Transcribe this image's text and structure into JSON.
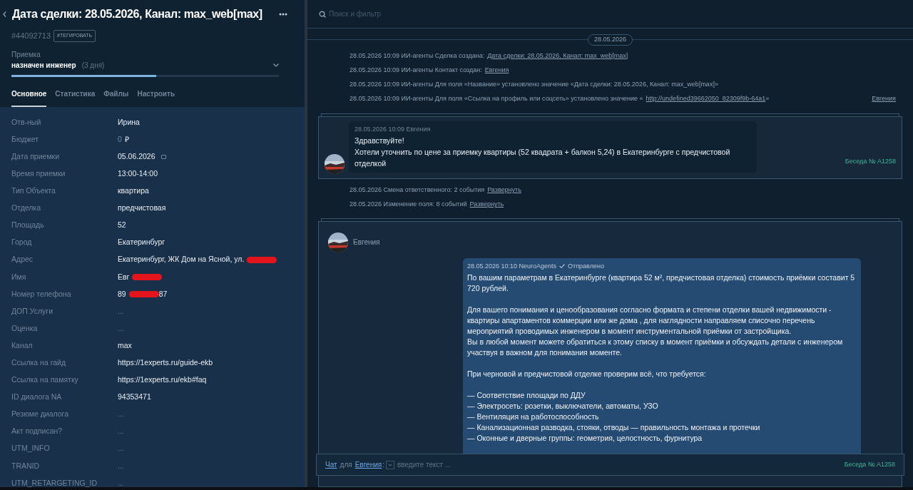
{
  "lead": {
    "title": "Дата сделки: 28.05.2026, Канал: max_web[max]",
    "id": "#44092713",
    "tag_button": "#ТЕГИРОВАТЬ",
    "pipeline": "Приемка",
    "stage": "назначен инженер",
    "stage_age": "(3 дня)",
    "stage_bar": {
      "level": 0.54
    },
    "tabs": [
      {
        "label": "Основное",
        "selected": true
      },
      {
        "label": "Статистика",
        "selected": false
      },
      {
        "label": "Файлы",
        "selected": false
      },
      {
        "label": "Настроить",
        "selected": false
      }
    ],
    "fields": [
      {
        "label": "Отв-ный",
        "value": "Ирина"
      },
      {
        "label": "Бюджет",
        "value": "0",
        "unit": "₽"
      },
      {
        "label": "Дата приемки",
        "value": "05.06.2026",
        "kind": "date"
      },
      {
        "label": "Время приемки",
        "value": "13:00-14:00"
      },
      {
        "label": "Тип Объекта",
        "value": "квартира"
      },
      {
        "label": "Отделка",
        "value": "предчистовая"
      },
      {
        "label": "Площадь",
        "value": "52"
      },
      {
        "label": "Город",
        "value": "Екатеринбург"
      },
      {
        "label": "Адрес",
        "value": "Екатеринбург, ЖК Дом на Ясной, ул.",
        "redacted": true
      },
      {
        "label": "Имя",
        "value": "Евг",
        "redacted": true
      },
      {
        "label": "Номер телефона",
        "value": "89",
        "redacted": true,
        "value_end": "87"
      },
      {
        "label": "ДОП Услуги",
        "value": "...",
        "empty": true
      },
      {
        "label": "Оценка",
        "value": "...",
        "empty": true
      },
      {
        "label": "Канал",
        "value": "max"
      },
      {
        "label": "Ссылка на гайд",
        "value": "https://1experts.ru/guide-ekb"
      },
      {
        "label": "Ссылка на памятку",
        "value": "https://1experts.ru/ekb#faq"
      },
      {
        "label": "ID диалога NA",
        "value": "94353471"
      },
      {
        "label": "Резюме диалога",
        "value": "...",
        "empty": true
      },
      {
        "label": "Акт подписан?",
        "value": "...",
        "empty": true
      },
      {
        "label": "UTM_INFO",
        "value": "...",
        "empty": true
      },
      {
        "label": "TRANID",
        "value": "...",
        "empty": true
      },
      {
        "label": "UTM_RETARGETING_ID",
        "value": "...",
        "empty": true
      }
    ]
  },
  "feed": {
    "search_placeholder": "Поиск и фильтр",
    "date": "28.05.2026",
    "events": [
      {
        "text": "28.05.2026 10:09 ИИ-агенты Сделка создана:",
        "link": "Дата сделки: 28.05.2026, Канал: max_web[max]"
      },
      {
        "text": "28.05.2026 10:09 ИИ-агенты Контакт создан:",
        "link": "Евгения"
      },
      {
        "text": "28.05.2026 10:09 ИИ-агенты Для поля «Название» установлено значение «Дата сделки: 28.05.2026, Канал: max_web[max]»"
      },
      {
        "text": "28.05.2026 10:09 ИИ-агенты Для поля «Ссылка на профиль или соцсеть» установлено значение «",
        "link": "http://undefined39662050_82309f9b-64a1",
        "tail": "»",
        "author": "Евгения"
      }
    ],
    "incoming": {
      "meta": "28.05.2026 10:09 Евгения",
      "lines": [
        "Здравствуйте!",
        "Хотели уточнить по цене за приемку квартиры (52 квадрата + балкон 5,24) в Екатеринбурге с предчистовой отделкой"
      ],
      "conversation": "Беседа № А1258"
    },
    "collapsed": [
      {
        "text": "28.05.2026 Смена ответственного: 2 события",
        "link": "Развернуть"
      },
      {
        "text": "28.05.2026 Изменение поля: 8 событий",
        "link": "Развернуть"
      }
    ],
    "outgoing": {
      "contact": "Евгения",
      "meta": "28.05.2026 10:10 NeuroAgents",
      "status": "Отправлено",
      "paragraphs": [
        [
          "По вашим параметрам в Екатеринбурге (квартира 52 м², предчистовая отделка) стоимость приёмки составит 5 720 рублей."
        ],
        [
          "Для вашего понимания и ценообразования согласно формата и степени отделки вашей недвижимости - квартиры апартаментов коммерции или же дома , для наглядности направляем списочно перечень мероприятий проводимых инженером в момент инструментальной приёмки от застройщика.",
          "Вы в любой момент можете обратиться к этому списку в момент приёмки и обсуждать детали с инженером участвуя в важном для понимания моменте."
        ],
        [
          "При черновой и предчистовой отделке проверим всё, что требуется:"
        ],
        [
          "— Соответствие площади по ДДУ",
          "— Электросеть: розетки, выключатели, автоматы, УЗО",
          "— Вентиляция на работоспособность",
          "— Канализационная разводка, стояки, отводы — правильность монтажа и протечки",
          "— Оконные и дверные группы: геометрия, целостность, фурнитура"
        ]
      ]
    },
    "composer": {
      "channel": "Чат",
      "for": "для",
      "contact": "Евгения",
      "colon": ":",
      "placeholder": "введите текст ...",
      "conversation": "Беседа № А1258"
    }
  }
}
